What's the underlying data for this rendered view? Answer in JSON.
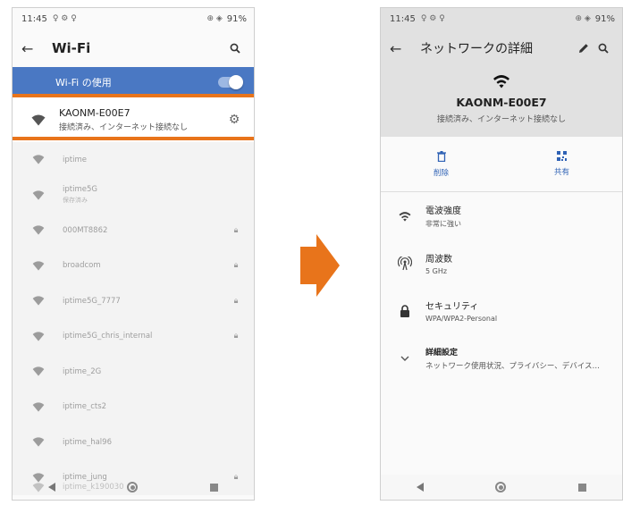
{
  "left": {
    "status": {
      "time": "11:45",
      "battery": "91%"
    },
    "title": "Wi-Fi",
    "toggle_label": "Wi-Fi の使用",
    "connected": {
      "name": "KAONM-E00E7",
      "status": "接続済み、インターネット接続なし"
    },
    "networks": [
      {
        "name": "iptime",
        "sub": "",
        "locked": false
      },
      {
        "name": "iptime5G",
        "sub": "保存済み",
        "locked": false
      },
      {
        "name": "000MT8862",
        "sub": "",
        "locked": true
      },
      {
        "name": "broadcom",
        "sub": "",
        "locked": true
      },
      {
        "name": "iptime5G_7777",
        "sub": "",
        "locked": true
      },
      {
        "name": "iptime5G_chris_internal",
        "sub": "",
        "locked": true
      },
      {
        "name": "iptime_2G",
        "sub": "",
        "locked": false
      },
      {
        "name": "iptime_cts2",
        "sub": "",
        "locked": false
      },
      {
        "name": "iptime_hal96",
        "sub": "",
        "locked": false
      },
      {
        "name": "iptime_jung",
        "sub": "",
        "locked": true
      }
    ],
    "ghost_network": "iptime_k190030"
  },
  "right": {
    "status": {
      "time": "11:45",
      "battery": "91%"
    },
    "title": "ネットワークの詳細",
    "network_name": "KAONM-E00E7",
    "network_status": "接続済み、インターネット接続なし",
    "delete_label": "削除",
    "share_label": "共有",
    "signal_label": "電波強度",
    "signal_value": "非常に強い",
    "freq_label": "周波数",
    "freq_value": "5 GHz",
    "security_label": "セキュリティ",
    "security_value": "WPA/WPA2-Personal",
    "advanced_label": "詳細設定",
    "advanced_value": "ネットワーク使用状況、プライバシー、デバイス…"
  },
  "colors": {
    "accent": "#4a78c3",
    "highlight": "#e8741b",
    "arrow": "#e8741b"
  }
}
